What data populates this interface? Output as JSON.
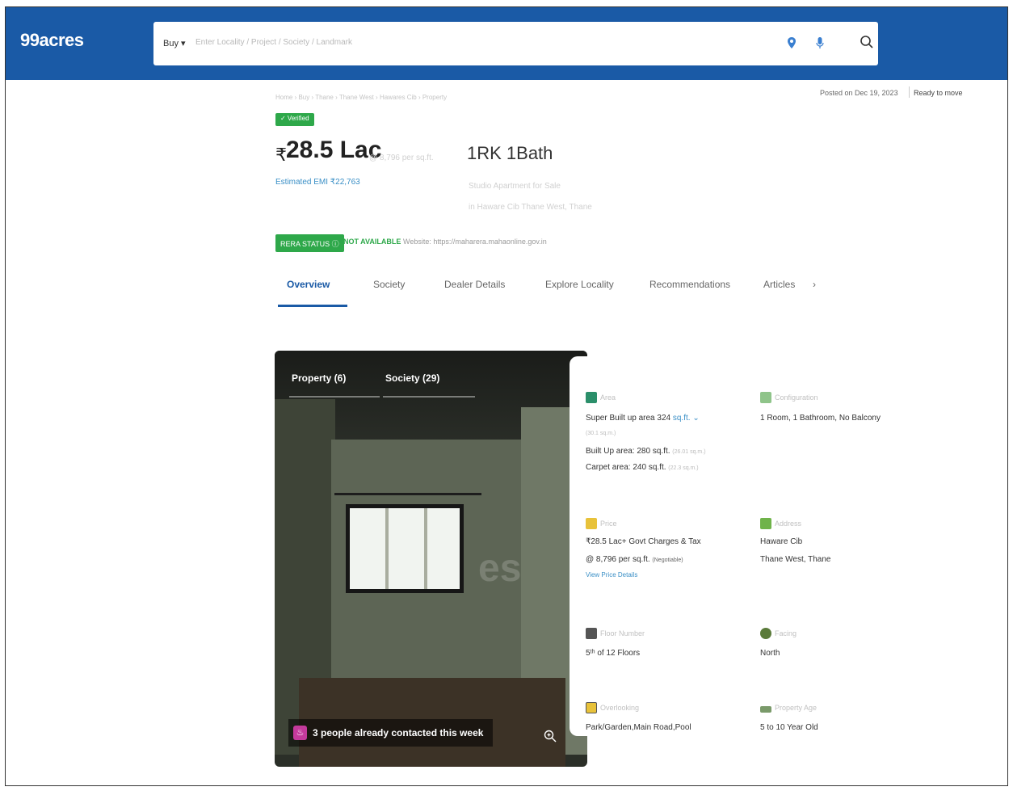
{
  "header": {
    "logo": "99acres",
    "buy_label": "Buy ▾",
    "search_placeholder": "Enter Locality / Project / Society / Landmark"
  },
  "meta": {
    "breadcrumb": "Home › Buy › Thane › Thane West › Hawares Cib › Property",
    "posted": "Posted on Dec 19, 2023",
    "status": "Ready to move"
  },
  "listing": {
    "verified": "✓ Verified",
    "price_symbol": "₹",
    "price": "28.5 Lac",
    "price_sub": "@ 8,796 per sq.ft.",
    "emi": "Estimated EMI ₹22,763",
    "config": "1RK 1Bath",
    "config_sub1": "Studio Apartment for Sale",
    "config_sub2": "in Haware Cib Thane West, Thane",
    "rera_label": "RERA STATUS ⓘ",
    "rera_value": "NOT AVAILABLE",
    "rera_website": "Website: https://maharera.mahaonline.gov.in"
  },
  "tabs": [
    "Overview",
    "Society",
    "Dealer Details",
    "Explore Locality",
    "Recommendations",
    "Articles",
    "›"
  ],
  "gallery": {
    "tab_property": "Property (6)",
    "tab_society": "Society (29)",
    "watermark": "es",
    "contact": "3 people already contacted this week"
  },
  "details": {
    "area": {
      "label": "Area",
      "line1": "Super Built up area 324",
      "unit": "sq.ft. ⌄",
      "sub1": "(30.1 sq.m.)",
      "line2": "Built Up area: 280 sq.ft.",
      "line2_sub": "(26.01 sq.m.)",
      "line3": "Carpet area: 240 sq.ft.",
      "line3_sub": "(22.3 sq.m.)"
    },
    "configuration": {
      "label": "Configuration",
      "line1": "1 Room, 1 Bathroom, No Balcony"
    },
    "price": {
      "label": "Price",
      "line1": "₹28.5 Lac+ Govt Charges & Tax",
      "line2": "@ 8,796 per sq.ft.",
      "negotiable": "(Negotiable)",
      "link": "View Price Details"
    },
    "address": {
      "label": "Address",
      "line1": "Haware Cib",
      "line2": "Thane West, Thane"
    },
    "floor": {
      "label": "Floor Number",
      "line1": "5ᵗʰ of 12 Floors"
    },
    "facing": {
      "label": "Facing",
      "line1": "North"
    },
    "overlooking": {
      "label": "Overlooking",
      "line1": "Park/Garden,Main Road,Pool"
    },
    "age": {
      "label": "Property Age",
      "line1": "5 to 10 Year Old"
    }
  },
  "colors": {
    "brand": "#1a5aa6",
    "green": "#2ea84a",
    "link": "#3a8fc6"
  }
}
